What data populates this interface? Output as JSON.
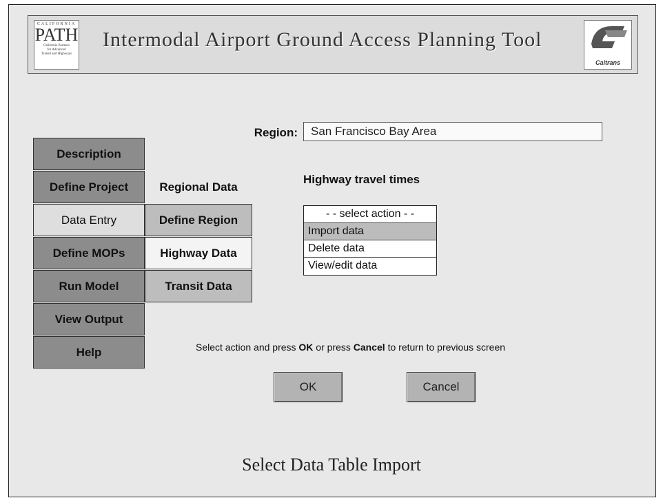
{
  "header": {
    "app_title": "Intermodal Airport Ground Access Planning Tool",
    "left_logo": {
      "name": "PATH",
      "top_text": "CALIFORNIA",
      "lines": [
        "California Partners",
        "for Advanced",
        "Transit and Highways"
      ]
    },
    "right_logo": {
      "name": "Caltrans"
    }
  },
  "nav": {
    "items": [
      {
        "label": "Description"
      },
      {
        "label": "Define Project"
      },
      {
        "label": "Data Entry"
      },
      {
        "label": "Define MOPs"
      },
      {
        "label": "Run Model"
      },
      {
        "label": "View Output"
      },
      {
        "label": "Help"
      }
    ],
    "active": "Data Entry"
  },
  "subnav": {
    "header": "Regional Data",
    "items": [
      {
        "label": "Define Region"
      },
      {
        "label": "Highway Data"
      },
      {
        "label": "Transit Data"
      }
    ],
    "active": "Highway Data"
  },
  "form": {
    "region_label": "Region:",
    "region_value": "San Francisco Bay Area",
    "section_title": "Highway travel times",
    "actions": {
      "placeholder": "- - select action - -",
      "options": [
        "Import data",
        "Delete data",
        "View/edit data"
      ],
      "selected": "Import data"
    }
  },
  "instruction": {
    "part1": "Select action and press ",
    "ok": "OK",
    "part2": " or press ",
    "cancel": "Cancel",
    "part3": " to return to previous screen"
  },
  "buttons": {
    "ok_label": "OK",
    "cancel_label": "Cancel"
  },
  "screen_caption": "Select Data Table Import",
  "colors": {
    "background": "#e8e8e8",
    "nav_inactive": "#8c8c8c",
    "nav_active": "#dedede",
    "subnav_inactive": "#bdbdbd",
    "subnav_active": "#f4f4f4",
    "option_selected": "#bcbcbc"
  }
}
